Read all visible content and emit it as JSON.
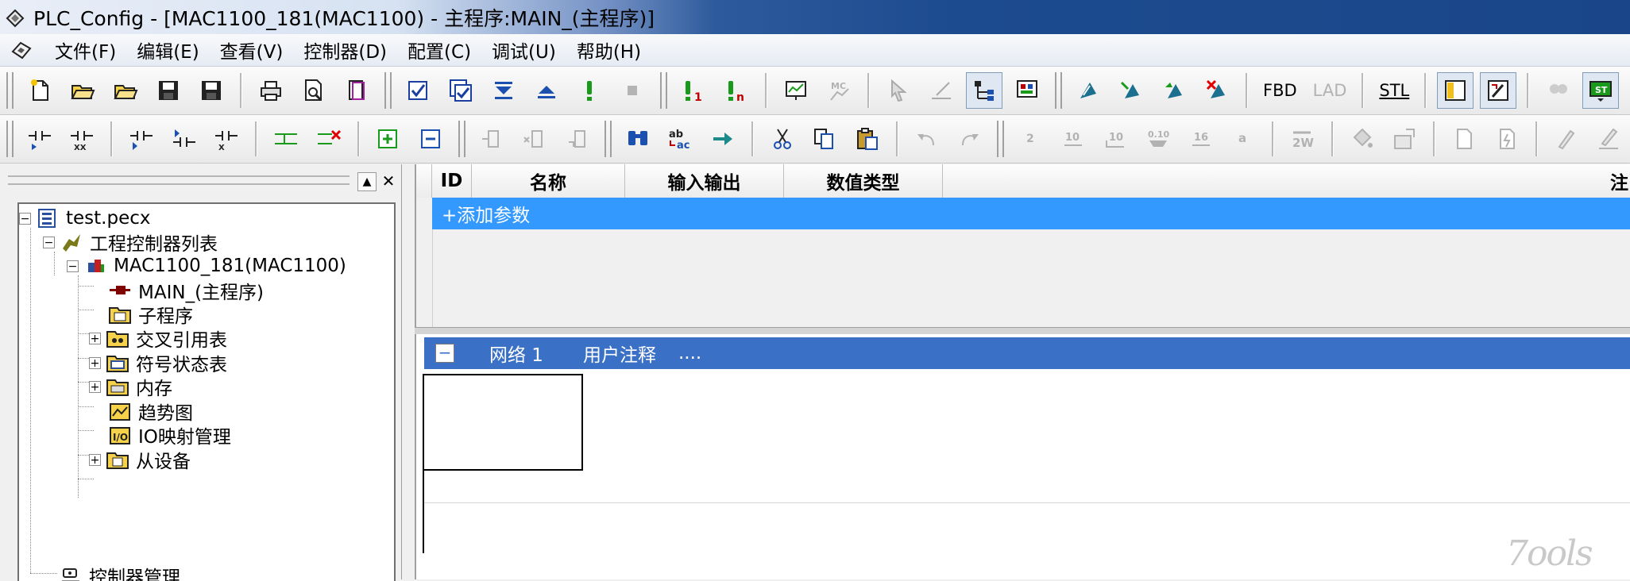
{
  "window": {
    "title": "PLC_Config - [MAC1100_181(MAC1100) - 主程序:MAIN_(主程序)]"
  },
  "menu": [
    "文件(F)",
    "编辑(E)",
    "查看(V)",
    "控制器(D)",
    "配置(C)",
    "调试(U)",
    "帮助(H)"
  ],
  "toolbar1": {
    "fbd_label": "FBD",
    "lad_label": "LAD",
    "stl_label": "STL"
  },
  "toolbar2": {
    "num_labels": [
      "2",
      "10",
      "10",
      "0.10",
      "16",
      "a",
      "2W"
    ]
  },
  "left_panel": {
    "tree": [
      {
        "label": "test.pecx",
        "icon": "project-icon"
      },
      {
        "label": "工程控制器列表",
        "icon": "controller-list-icon"
      },
      {
        "label": "MAC1100_181(MAC1100)",
        "icon": "plc-device-icon"
      },
      {
        "label": "MAIN_(主程序)",
        "icon": "main-program-icon"
      },
      {
        "label": "子程序",
        "icon": "subroutine-folder-icon"
      },
      {
        "label": "交叉引用表",
        "icon": "cross-ref-folder-icon"
      },
      {
        "label": "符号状态表",
        "icon": "symbol-status-folder-icon"
      },
      {
        "label": "内存",
        "icon": "memory-folder-icon"
      },
      {
        "label": "趋势图",
        "icon": "trend-chart-icon"
      },
      {
        "label": "IO映射管理",
        "icon": "io-mapping-icon"
      },
      {
        "label": "从设备",
        "icon": "slave-device-folder-icon"
      },
      {
        "label": "控制器管理",
        "icon": "controller-management-icon"
      }
    ]
  },
  "params_table": {
    "columns": [
      "ID",
      "名称",
      "输入输出",
      "数值类型"
    ],
    "last_column_partial": "注",
    "add_row": "+添加参数"
  },
  "network": {
    "collapse_symbol": "−",
    "label": "网络 1",
    "comment": "用户注释",
    "dots": "...."
  },
  "watermark": "7ools",
  "colors": {
    "selection_blue": "#3399ff",
    "network_bar": "#3a70c6",
    "title_dark": "#1a4689"
  }
}
